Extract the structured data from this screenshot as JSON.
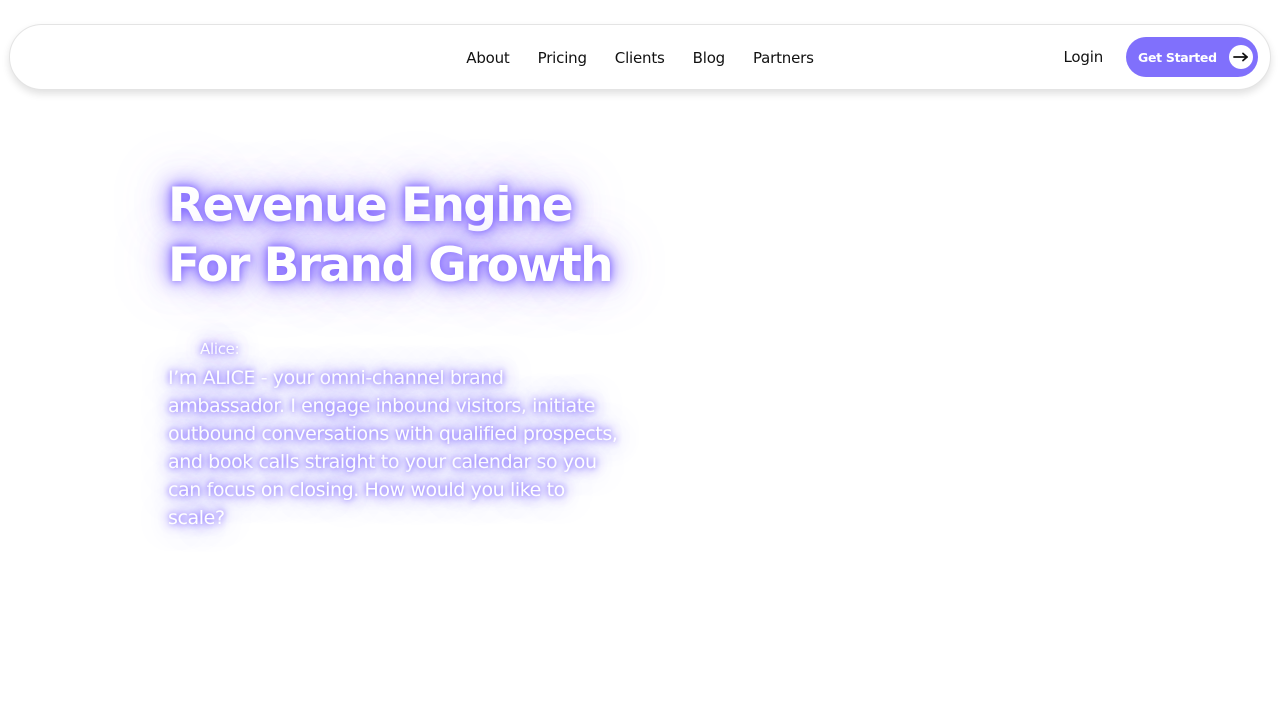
{
  "nav": {
    "links": [
      "About",
      "Pricing",
      "Clients",
      "Blog",
      "Partners"
    ],
    "login_label": "Login",
    "cta_label": "Get Started",
    "cta_icon": "arrow-right-icon"
  },
  "hero": {
    "title_line1": "Revenue Engine",
    "title_line2": "For Brand Growth",
    "speaker": "Alice:",
    "message": "I’m ALICE - your omni-channel brand ambassador. I engage inbound visitors, initiate outbound conversations with qualified prospects, and book calls straight to your calendar so you can focus on closing. How would you like to scale?"
  },
  "colors": {
    "accent": "#8070fc",
    "glow": "#7e64ff",
    "nav_text": "#111111",
    "background": "#ffffff"
  }
}
